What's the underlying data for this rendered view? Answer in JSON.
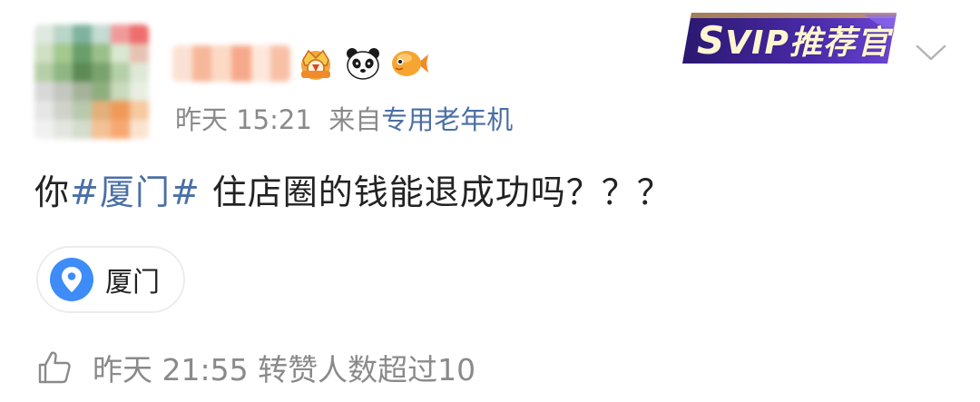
{
  "post": {
    "meta": {
      "time": "昨天 15:21",
      "source_prefix": "来自",
      "source_name": "专用老年机"
    },
    "text": {
      "prefix": "你",
      "topic": "#厦门#",
      "body": " 住店圈的钱能退成功吗？？？"
    },
    "location": {
      "label": "厦门"
    },
    "footer": {
      "text": "昨天 21:55 转赞人数超过10"
    },
    "badge": {
      "label_prefix": "S",
      "label_rest": "VIP推荐官"
    },
    "icons": {
      "crown_badge": "crown-badge-icon",
      "panda_badge": "panda-badge-icon",
      "fish_badge": "fish-badge-icon",
      "location": "location-pin-icon",
      "thumbs_up": "thumbs-up-icon",
      "chevron": "chevron-down-icon"
    },
    "colors": {
      "meta_gray": "#8a8a8a",
      "link_blue": "#4a6fa5",
      "pin_blue": "#3d8cf7",
      "svip_purple": "#3a1f86",
      "svip_gold": "#f2c24a"
    }
  }
}
